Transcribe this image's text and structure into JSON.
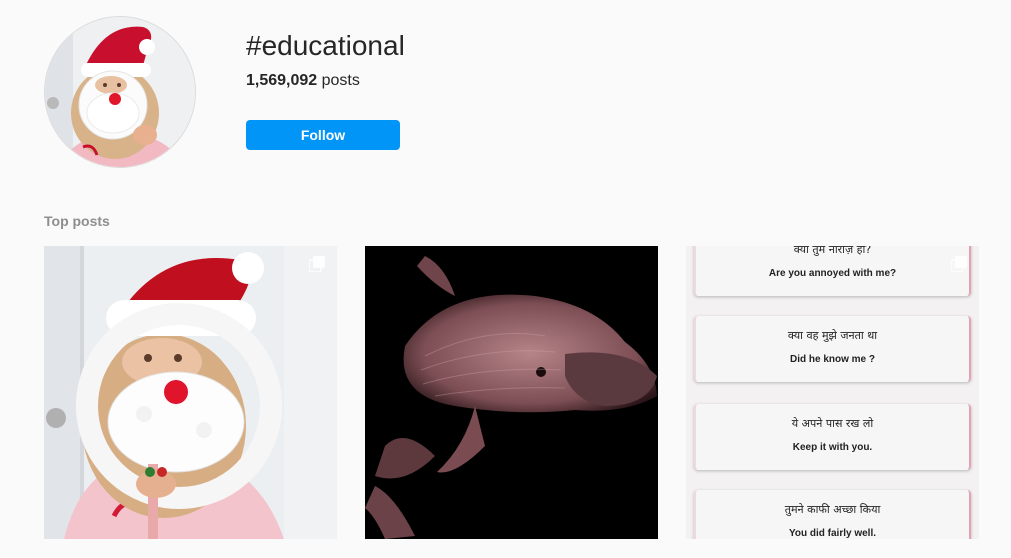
{
  "header": {
    "hashtag": "#educational",
    "post_count": "1,569,092",
    "post_count_suffix": " posts",
    "follow_label": "Follow"
  },
  "sections": {
    "top_posts_label": "Top posts"
  },
  "posts": [
    {
      "alt": "Child holding paper plate Santa craft",
      "kind": "photo"
    },
    {
      "alt": "Platypus skeleton x-ray image",
      "kind": "photo"
    },
    {
      "kind": "phrase-cards",
      "cards": [
        {
          "hindi": "क्या तुम नाराज़ हो?",
          "english": "Are you annoyed with me?"
        },
        {
          "hindi": "क्या वह मुझे जनता था",
          "english": "Did he know me ?"
        },
        {
          "hindi": "ये अपने पास रख लो",
          "english": "Keep it with you."
        },
        {
          "hindi": "तुमने काफी अच्छा किया",
          "english": "You did fairly well."
        }
      ]
    }
  ],
  "colors": {
    "background": "#fafafa",
    "follow_button": "#0095f6",
    "section_label": "#8e8e8e"
  },
  "icons": [
    "multiple-posts-icon"
  ]
}
